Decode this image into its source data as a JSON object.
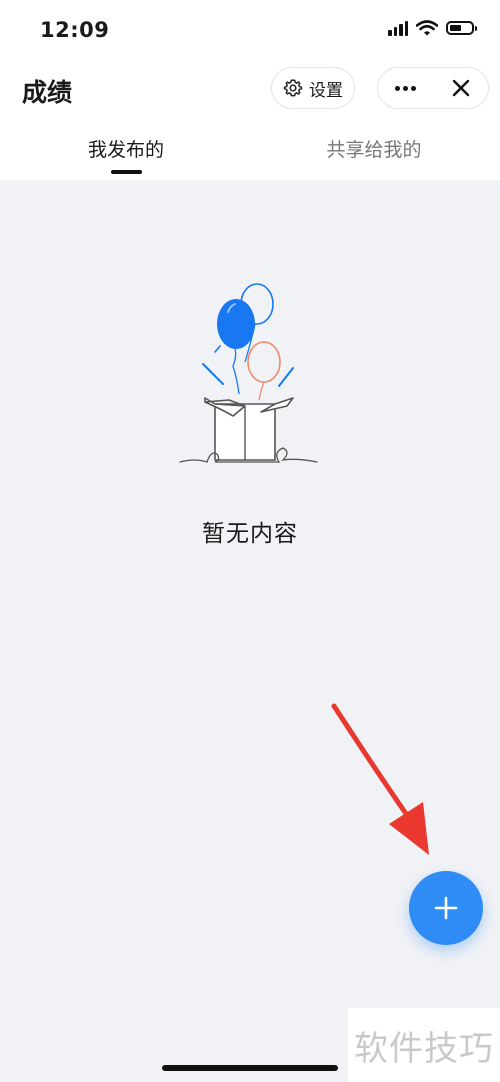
{
  "status_bar": {
    "time": "12:09",
    "signal_icon": "cellular-signal-icon",
    "wifi_icon": "wifi-icon",
    "battery_level": 0.4
  },
  "header": {
    "title": "成绩",
    "settings_label": "设置",
    "settings_icon": "gear-icon",
    "more_icon": "more-dots-icon",
    "close_icon": "close-icon"
  },
  "tabs": [
    {
      "label": "我发布的",
      "active": true
    },
    {
      "label": "共享给我的",
      "active": false
    }
  ],
  "empty_state": {
    "illustration": "gift-box-balloons-illustration",
    "text": "暂无内容"
  },
  "fab": {
    "icon": "plus-icon",
    "color": "#2f8cf5"
  },
  "annotation": {
    "arrow_color": "#e8382f"
  },
  "watermark": {
    "text": "软件技巧"
  },
  "colors": {
    "background": "#f1f2f5",
    "accent": "#2f8cf5",
    "balloon_blue": "#1778f2",
    "balloon_orange": "#ee8a6a"
  }
}
